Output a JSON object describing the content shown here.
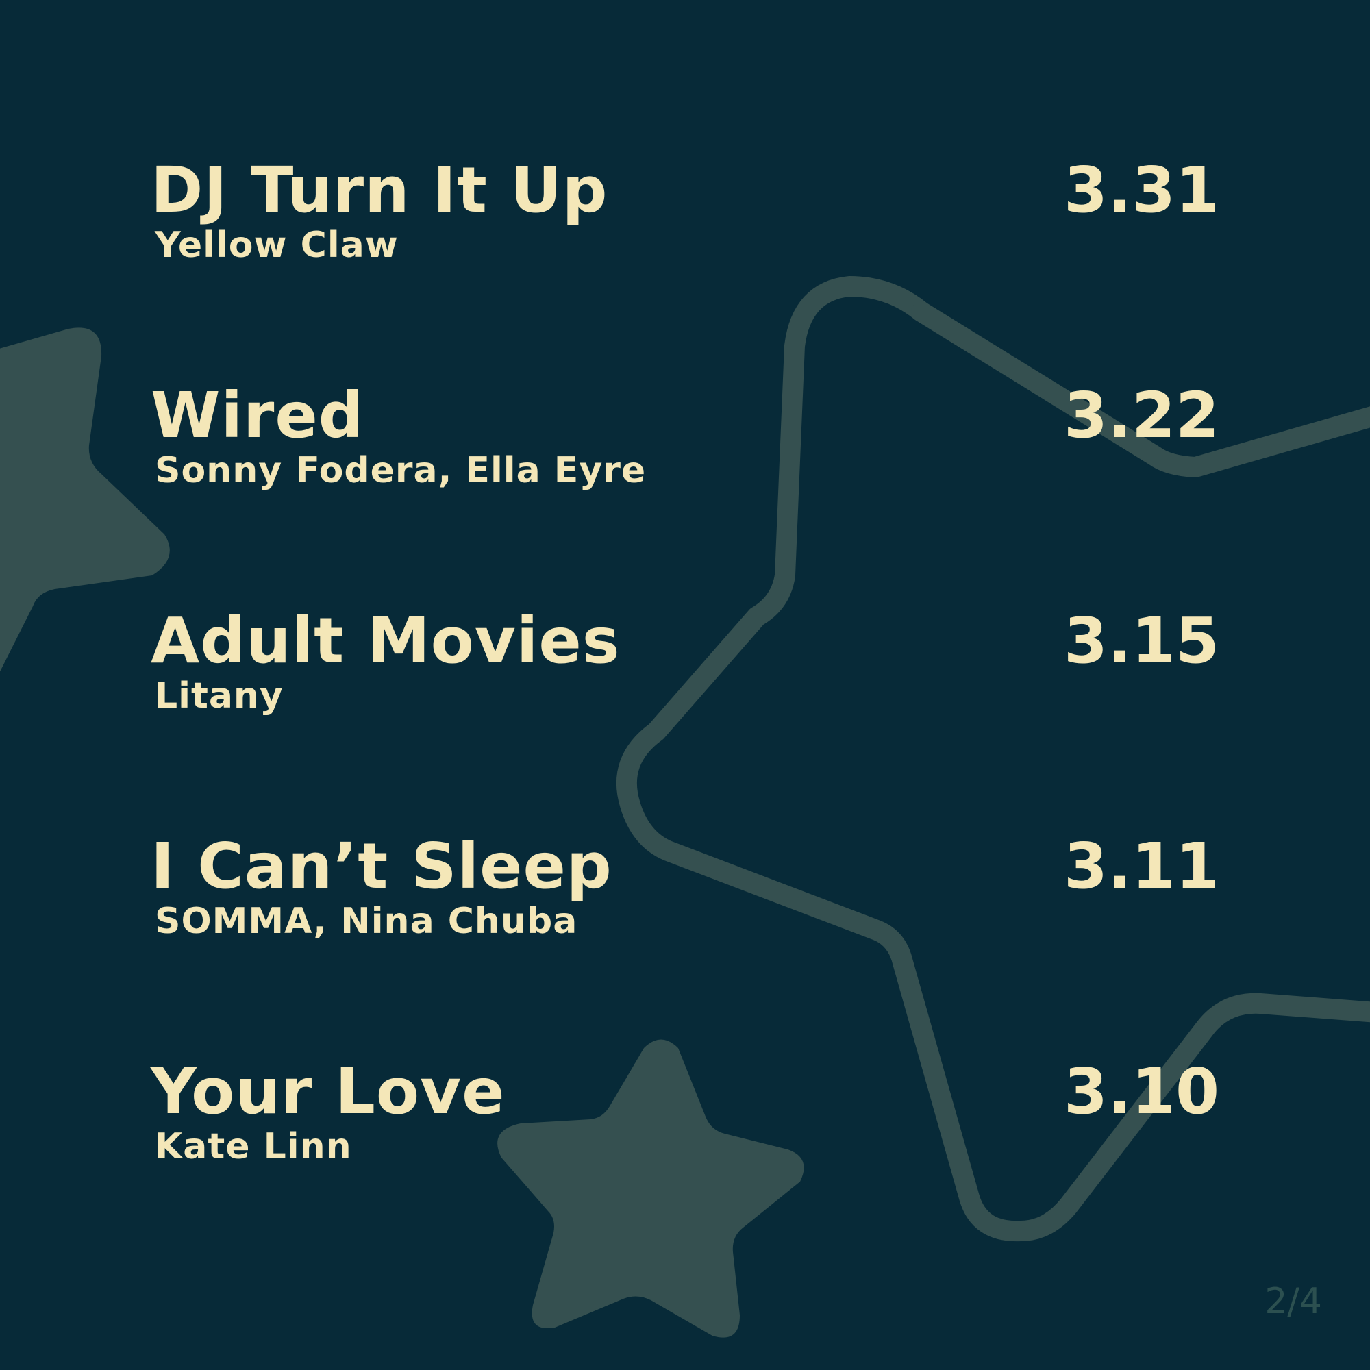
{
  "colors": {
    "background": "#072a38",
    "text": "#f4e7b8",
    "decor": "#355050",
    "page_indicator": "#2c5050"
  },
  "tracks": [
    {
      "title": "DJ Turn It Up",
      "artist": "Yellow Claw",
      "score": "3.31"
    },
    {
      "title": "Wired",
      "artist": "Sonny Fodera, Ella Eyre",
      "score": "3.22"
    },
    {
      "title": "Adult Movies",
      "artist": "Litany",
      "score": "3.15"
    },
    {
      "title": "I Can’t Sleep",
      "artist": "SOMMA, Nina Chuba",
      "score": "3.11"
    },
    {
      "title": "Your Love",
      "artist": "Kate Linn",
      "score": "3.10"
    }
  ],
  "page_indicator": "2/4",
  "decorations": {
    "left_star_icon": "star-icon",
    "bottom_star_icon": "star-icon",
    "outline_star_icon": "star-outline-icon"
  }
}
